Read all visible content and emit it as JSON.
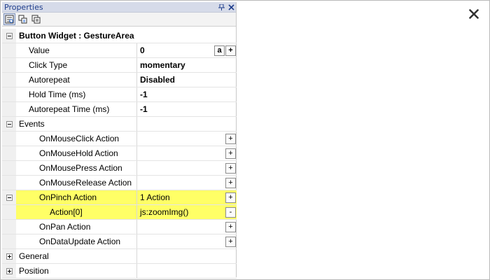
{
  "panel": {
    "title": "Properties",
    "pin_glyph": "⍅",
    "close_glyph": "✕"
  },
  "toolbar": {
    "tools": [
      {
        "icon": "categorized-view-icon",
        "active": true
      },
      {
        "icon": "alphabetical-view-icon",
        "active": false
      },
      {
        "icon": "property-pages-icon",
        "active": false
      }
    ]
  },
  "grid": {
    "header": "Button Widget : GestureArea",
    "properties": [
      {
        "name": "Value",
        "value": "0"
      },
      {
        "name": "Click Type",
        "value": "momentary"
      },
      {
        "name": "Autorepeat",
        "value": "Disabled"
      },
      {
        "name": "Hold Time (ms)",
        "value": "-1"
      },
      {
        "name": "Autorepeat Time (ms)",
        "value": "-1"
      }
    ],
    "value_buttons": {
      "a": "a",
      "plus": "+"
    },
    "events_label": "Events",
    "events": [
      {
        "name": "OnMouseClick Action",
        "value": ""
      },
      {
        "name": "OnMouseHold Action",
        "value": ""
      },
      {
        "name": "OnMousePress Action",
        "value": ""
      },
      {
        "name": "OnMouseRelease Action",
        "value": ""
      },
      {
        "name": "OnPinch Action",
        "value": "1 Action"
      },
      {
        "name": "Action[0]",
        "value": "js:zoomImg()"
      },
      {
        "name": "OnPan Action",
        "value": ""
      },
      {
        "name": "OnDataUpdate Action",
        "value": ""
      }
    ],
    "plus_label": "+",
    "minus_label": "-",
    "general_label": "General",
    "position_label": "Position"
  },
  "colors": {
    "highlight": "#ffff66",
    "titlebar": "#d6dbe9",
    "title_text": "#1f3e8c"
  },
  "close_icon": "close-icon"
}
